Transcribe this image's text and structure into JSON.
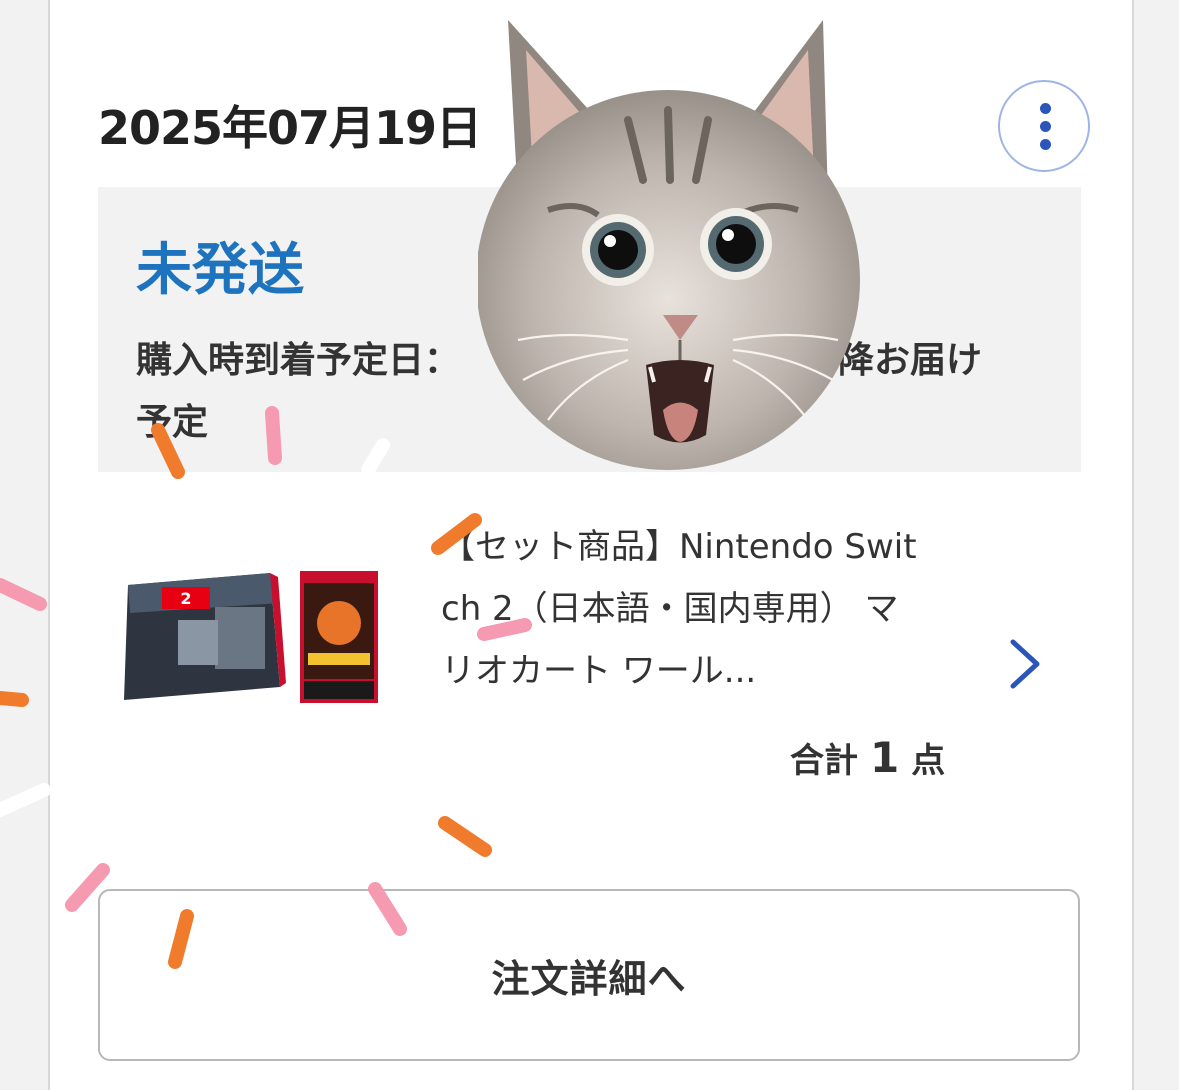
{
  "order": {
    "date": "2025年07月19日",
    "more_icon": "vertical-ellipsis-icon",
    "status": {
      "label": "未発送",
      "arrival_prefix": "購入時到着予定日：",
      "arrival_suffix": "降お届け",
      "arrival_line2": "予定"
    },
    "item": {
      "title_lines": [
        "【セット商品】Nintendo Swit",
        "ch 2（日本語・国内専用） マ",
        "リオカート ワール..."
      ],
      "chevron_icon": "chevron-right-icon"
    },
    "total": {
      "label": "合計",
      "count": "1",
      "unit": "点"
    },
    "detail_button_label": "注文詳細へ"
  },
  "colors": {
    "status_blue": "#1e73be",
    "icon_blue": "#2b55b8",
    "confetti_orange": "#f07b2c",
    "confetti_pink": "#f59ab0"
  }
}
